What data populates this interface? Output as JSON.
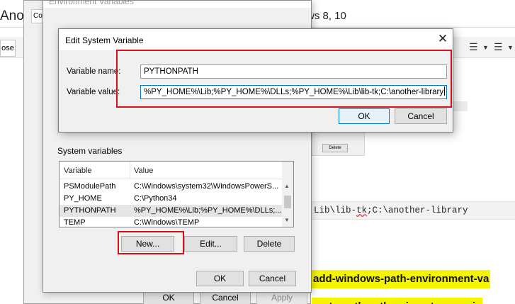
{
  "background": {
    "title_left": "Anon",
    "title_right": "ws 8, 10",
    "left_button": "ose",
    "code_prefix": "Lib\\lib-",
    "code_squiggle": "tk",
    "code_suffix": ";C:\\another-library",
    "highlight_line1": "add-windows-path-environment-va",
    "highlight_line2": "on to path python is not recogniz",
    "pane_delete_label": "Delete"
  },
  "system_properties": {
    "tab_label": "Co",
    "ok_label": "OK",
    "cancel_label": "Cancel",
    "apply_label": "Apply"
  },
  "env_window": {
    "title": "Environment Variables",
    "system_variables_label": "System variables",
    "columns": {
      "variable": "Variable",
      "value": "Value"
    },
    "rows": [
      {
        "variable": "PSModulePath",
        "value": "C:\\Windows\\system32\\WindowsPowerS..."
      },
      {
        "variable": "PY_HOME",
        "value": "C:\\Python34"
      },
      {
        "variable": "PYTHONPATH",
        "value": "%PY_HOME%\\Lib;%PY_HOME%\\DLLs;..."
      },
      {
        "variable": "TEMP",
        "value": "C:\\Windows\\TEMP"
      }
    ],
    "new_label": "New...",
    "edit_label": "Edit...",
    "delete_label": "Delete",
    "ok_label": "OK",
    "cancel_label": "Cancel"
  },
  "edit_dialog": {
    "title": "Edit System Variable",
    "name_label": "Variable name:",
    "name_value": "PYTHONPATH",
    "value_label": "Variable value:",
    "value_value": "%PY_HOME%\\Lib;%PY_HOME%\\DLLs;%PY_HOME%\\Lib\\lib-tk;C:\\another-library",
    "ok_label": "OK",
    "cancel_label": "Cancel"
  },
  "icons": {
    "close": "close-icon",
    "scroll_up": "scroll-up-icon",
    "scroll_down": "scroll-down-icon",
    "align": "align-icon"
  },
  "colors": {
    "annotation_red": "#d9101a",
    "highlight_yellow": "#f5f500",
    "focus_blue": "#0078d7"
  }
}
